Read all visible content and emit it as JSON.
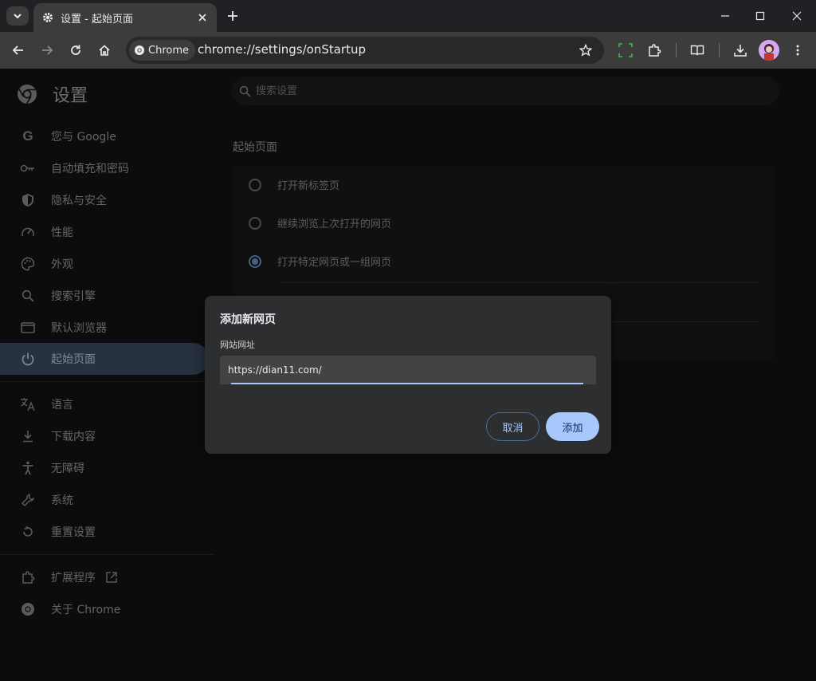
{
  "tab": {
    "title": "设置 - 起始页面"
  },
  "omnibox": {
    "chip": "Chrome",
    "url": "chrome://settings/onStartup"
  },
  "settings": {
    "title": "设置",
    "search_placeholder": "搜索设置"
  },
  "sidebar": {
    "items": [
      {
        "label": "您与 Google",
        "icon": "google-icon"
      },
      {
        "label": "自动填充和密码",
        "icon": "key-icon"
      },
      {
        "label": "隐私与安全",
        "icon": "shield-icon"
      },
      {
        "label": "性能",
        "icon": "speedometer-icon"
      },
      {
        "label": "外观",
        "icon": "palette-icon"
      },
      {
        "label": "搜索引擎",
        "icon": "search-icon"
      },
      {
        "label": "默认浏览器",
        "icon": "browser-icon"
      },
      {
        "label": "起始页面",
        "icon": "power-icon",
        "active": true
      },
      {
        "label": "语言",
        "icon": "translate-icon"
      },
      {
        "label": "下载内容",
        "icon": "download-icon"
      },
      {
        "label": "无障碍",
        "icon": "accessibility-icon"
      },
      {
        "label": "系统",
        "icon": "wrench-icon"
      },
      {
        "label": "重置设置",
        "icon": "reset-icon"
      },
      {
        "label": "扩展程序",
        "icon": "extension-icon"
      },
      {
        "label": "关于 Chrome",
        "icon": "chrome-icon"
      }
    ]
  },
  "startup": {
    "section_title": "起始页面",
    "options": [
      {
        "label": "打开新标签页",
        "checked": false
      },
      {
        "label": "继续浏览上次打开的网页",
        "checked": false
      },
      {
        "label": "打开特定网页或一组网页",
        "checked": true
      }
    ]
  },
  "dialog": {
    "title": "添加新网页",
    "field_label": "网站网址",
    "field_value": "https://dian11.com/",
    "cancel_label": "取消",
    "add_label": "添加"
  },
  "colors": {
    "accent": "#a8c7fa",
    "active_nav": "#3c4c62",
    "radio_checked": "#6e8fc8"
  }
}
